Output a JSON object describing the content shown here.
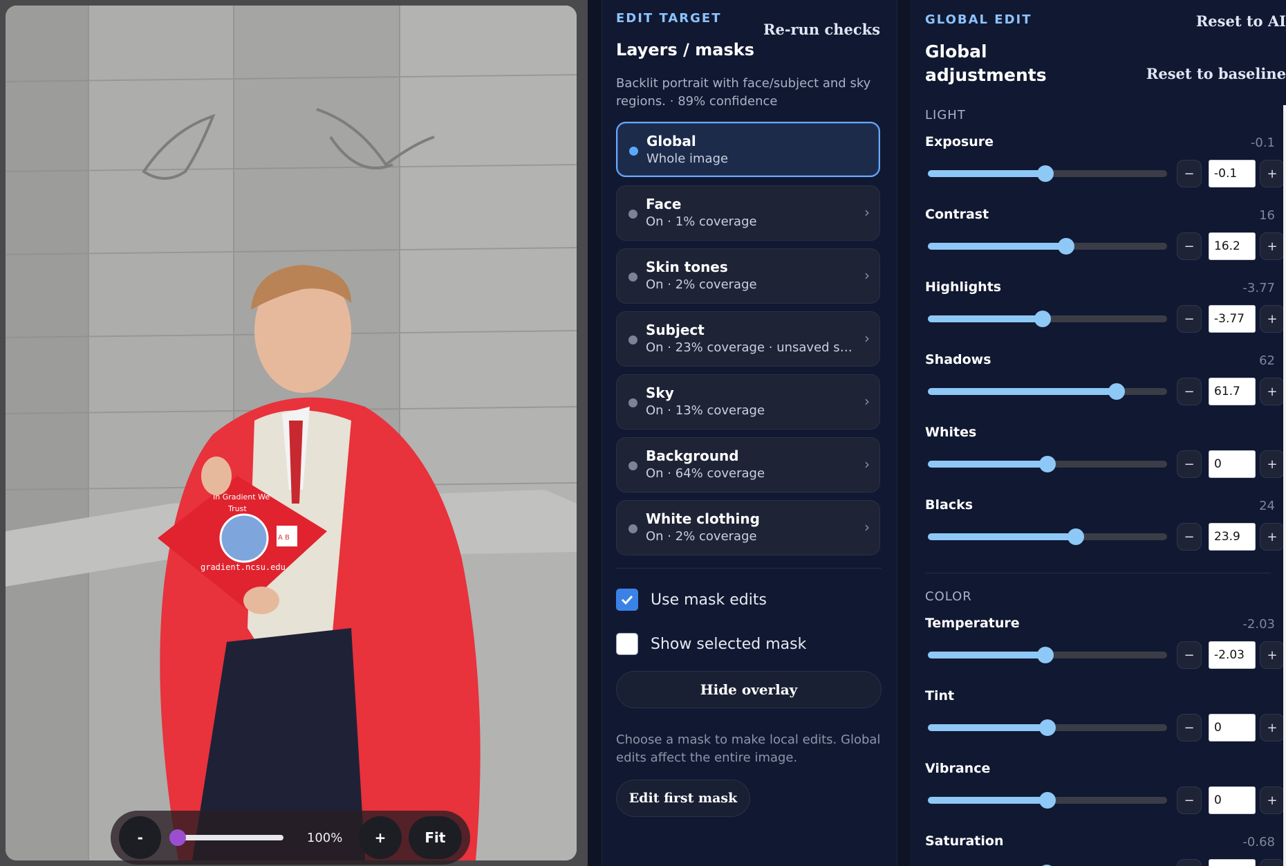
{
  "zoom": {
    "minus": "-",
    "value": "100%",
    "plus": "+",
    "fit": "Fit",
    "level": 0.0
  },
  "mid": {
    "section": "EDIT TARGET",
    "rerun": "Re-run checks",
    "title": "Layers / masks",
    "description": "Backlit portrait with face/subject and sky regions. · 89% confidence",
    "masks": [
      {
        "name": "Global",
        "sub": "Whole image",
        "active": true
      },
      {
        "name": "Face",
        "sub": "On · 1% coverage",
        "chevron": "›"
      },
      {
        "name": "Skin tones",
        "sub": "On · 2% coverage",
        "chevron": "›"
      },
      {
        "name": "Subject",
        "sub": "On · 23% coverage · unsaved sh…",
        "chevron": "›"
      },
      {
        "name": "Sky",
        "sub": "On · 13% coverage",
        "chevron": "›"
      },
      {
        "name": "Background",
        "sub": "On · 64% coverage",
        "chevron": "›"
      },
      {
        "name": "White clothing",
        "sub": "On · 2% coverage",
        "chevron": "›"
      }
    ],
    "use_mask_edits": {
      "label": "Use mask edits",
      "checked": true
    },
    "show_selected_mask": {
      "label": "Show selected mask",
      "checked": false
    },
    "hide_overlay": "Hide overlay",
    "hint": "Choose a mask to make local edits. Global edits affect the entire image.",
    "edit_first_mask": "Edit first mask"
  },
  "right": {
    "section": "GLOBAL EDIT",
    "reset_ai": "Reset to AI",
    "reset_baseline": "Reset to baseline",
    "title": "Global adjustments",
    "light_label": "LIGHT",
    "color_label": "COLOR",
    "minus": "−",
    "plus": "+",
    "adjustments": [
      {
        "name": "Exposure",
        "display": "-0.1",
        "input": "-0.1",
        "pos": 0.49
      },
      {
        "name": "Contrast",
        "display": "16",
        "input": "16.2",
        "pos": 0.578
      },
      {
        "name": "Highlights",
        "display": "-3.77",
        "input": "-3.77",
        "pos": 0.481
      },
      {
        "name": "Shadows",
        "display": "62",
        "input": "61.7",
        "pos": 0.79
      },
      {
        "name": "Whites",
        "display": "",
        "input": "0",
        "pos": 0.5
      },
      {
        "name": "Blacks",
        "display": "24",
        "input": "23.9",
        "pos": 0.618
      },
      {
        "name": "Temperature",
        "display": "-2.03",
        "input": "-2.03",
        "pos": 0.49
      },
      {
        "name": "Tint",
        "display": "",
        "input": "0",
        "pos": 0.5
      },
      {
        "name": "Vibrance",
        "display": "",
        "input": "0",
        "pos": 0.5
      },
      {
        "name": "Saturation",
        "display": "-0.68",
        "input": "",
        "pos": 0.497
      }
    ]
  },
  "photo": {
    "cap_text_1": "In Gradient We",
    "cap_text_2": "Trust",
    "cap_url": "gradient.ncsu.edu",
    "cap_badge": "A B"
  },
  "colors": {
    "accent": "#8cc3ff",
    "slider": "#8ec8f6",
    "gown": "#e8323c",
    "zoom_knob": "#9b4fd0"
  }
}
